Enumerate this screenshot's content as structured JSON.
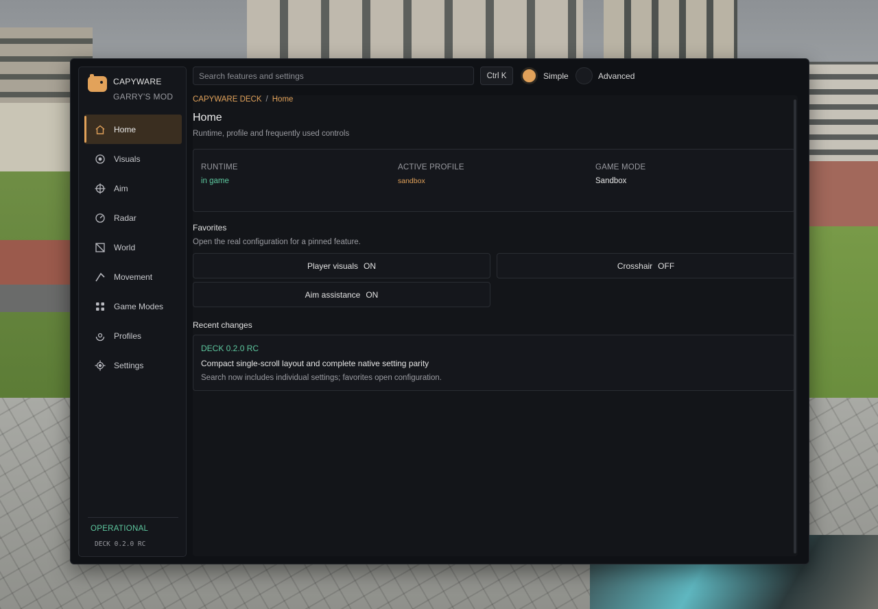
{
  "brand": {
    "name": "CAPYWARE",
    "subtitle": "GARRY'S MOD"
  },
  "sidebar": {
    "items": [
      {
        "label": "Home",
        "icon": "home-icon",
        "active": true
      },
      {
        "label": "Visuals",
        "icon": "eye-target-icon"
      },
      {
        "label": "Aim",
        "icon": "crosshair-icon"
      },
      {
        "label": "Radar",
        "icon": "radar-icon"
      },
      {
        "label": "World",
        "icon": "world-icon"
      },
      {
        "label": "Movement",
        "icon": "movement-icon"
      },
      {
        "label": "Game Modes",
        "icon": "grid-icon"
      },
      {
        "label": "Profiles",
        "icon": "profile-icon"
      },
      {
        "label": "Settings",
        "icon": "settings-icon"
      }
    ],
    "status": "OPERATIONAL",
    "version": "DECK 0.2.0 RC"
  },
  "topbar": {
    "search_placeholder": "Search features and settings",
    "shortcut": "Ctrl K",
    "modes": [
      {
        "label": "Simple",
        "selected": true
      },
      {
        "label": "Advanced",
        "selected": false
      }
    ]
  },
  "breadcrumb": {
    "root": "CAPYWARE DECK",
    "separator": "/",
    "current": "Home"
  },
  "page": {
    "title": "Home",
    "subtitle": "Runtime, profile and frequently used controls"
  },
  "stats": [
    {
      "key": "RUNTIME",
      "value": "in game"
    },
    {
      "key": "ACTIVE PROFILE",
      "value": "sandbox"
    },
    {
      "key": "GAME MODE",
      "value": "Sandbox"
    }
  ],
  "favorites": {
    "title": "Favorites",
    "subtitle": "Open the real configuration for a pinned feature.",
    "items": [
      {
        "name": "Player visuals",
        "state": "ON"
      },
      {
        "name": "Crosshair",
        "state": "OFF"
      },
      {
        "name": "Aim assistance",
        "state": "ON"
      }
    ]
  },
  "recent": {
    "title": "Recent changes",
    "version": "DECK 0.2.0 RC",
    "headline": "Compact single-scroll layout and complete native setting parity",
    "description": "Search now includes individual settings; favorites open configuration."
  },
  "colors": {
    "accent": "#e2a25a",
    "status_green": "#5ec9a0",
    "panel": "#0f1115"
  }
}
